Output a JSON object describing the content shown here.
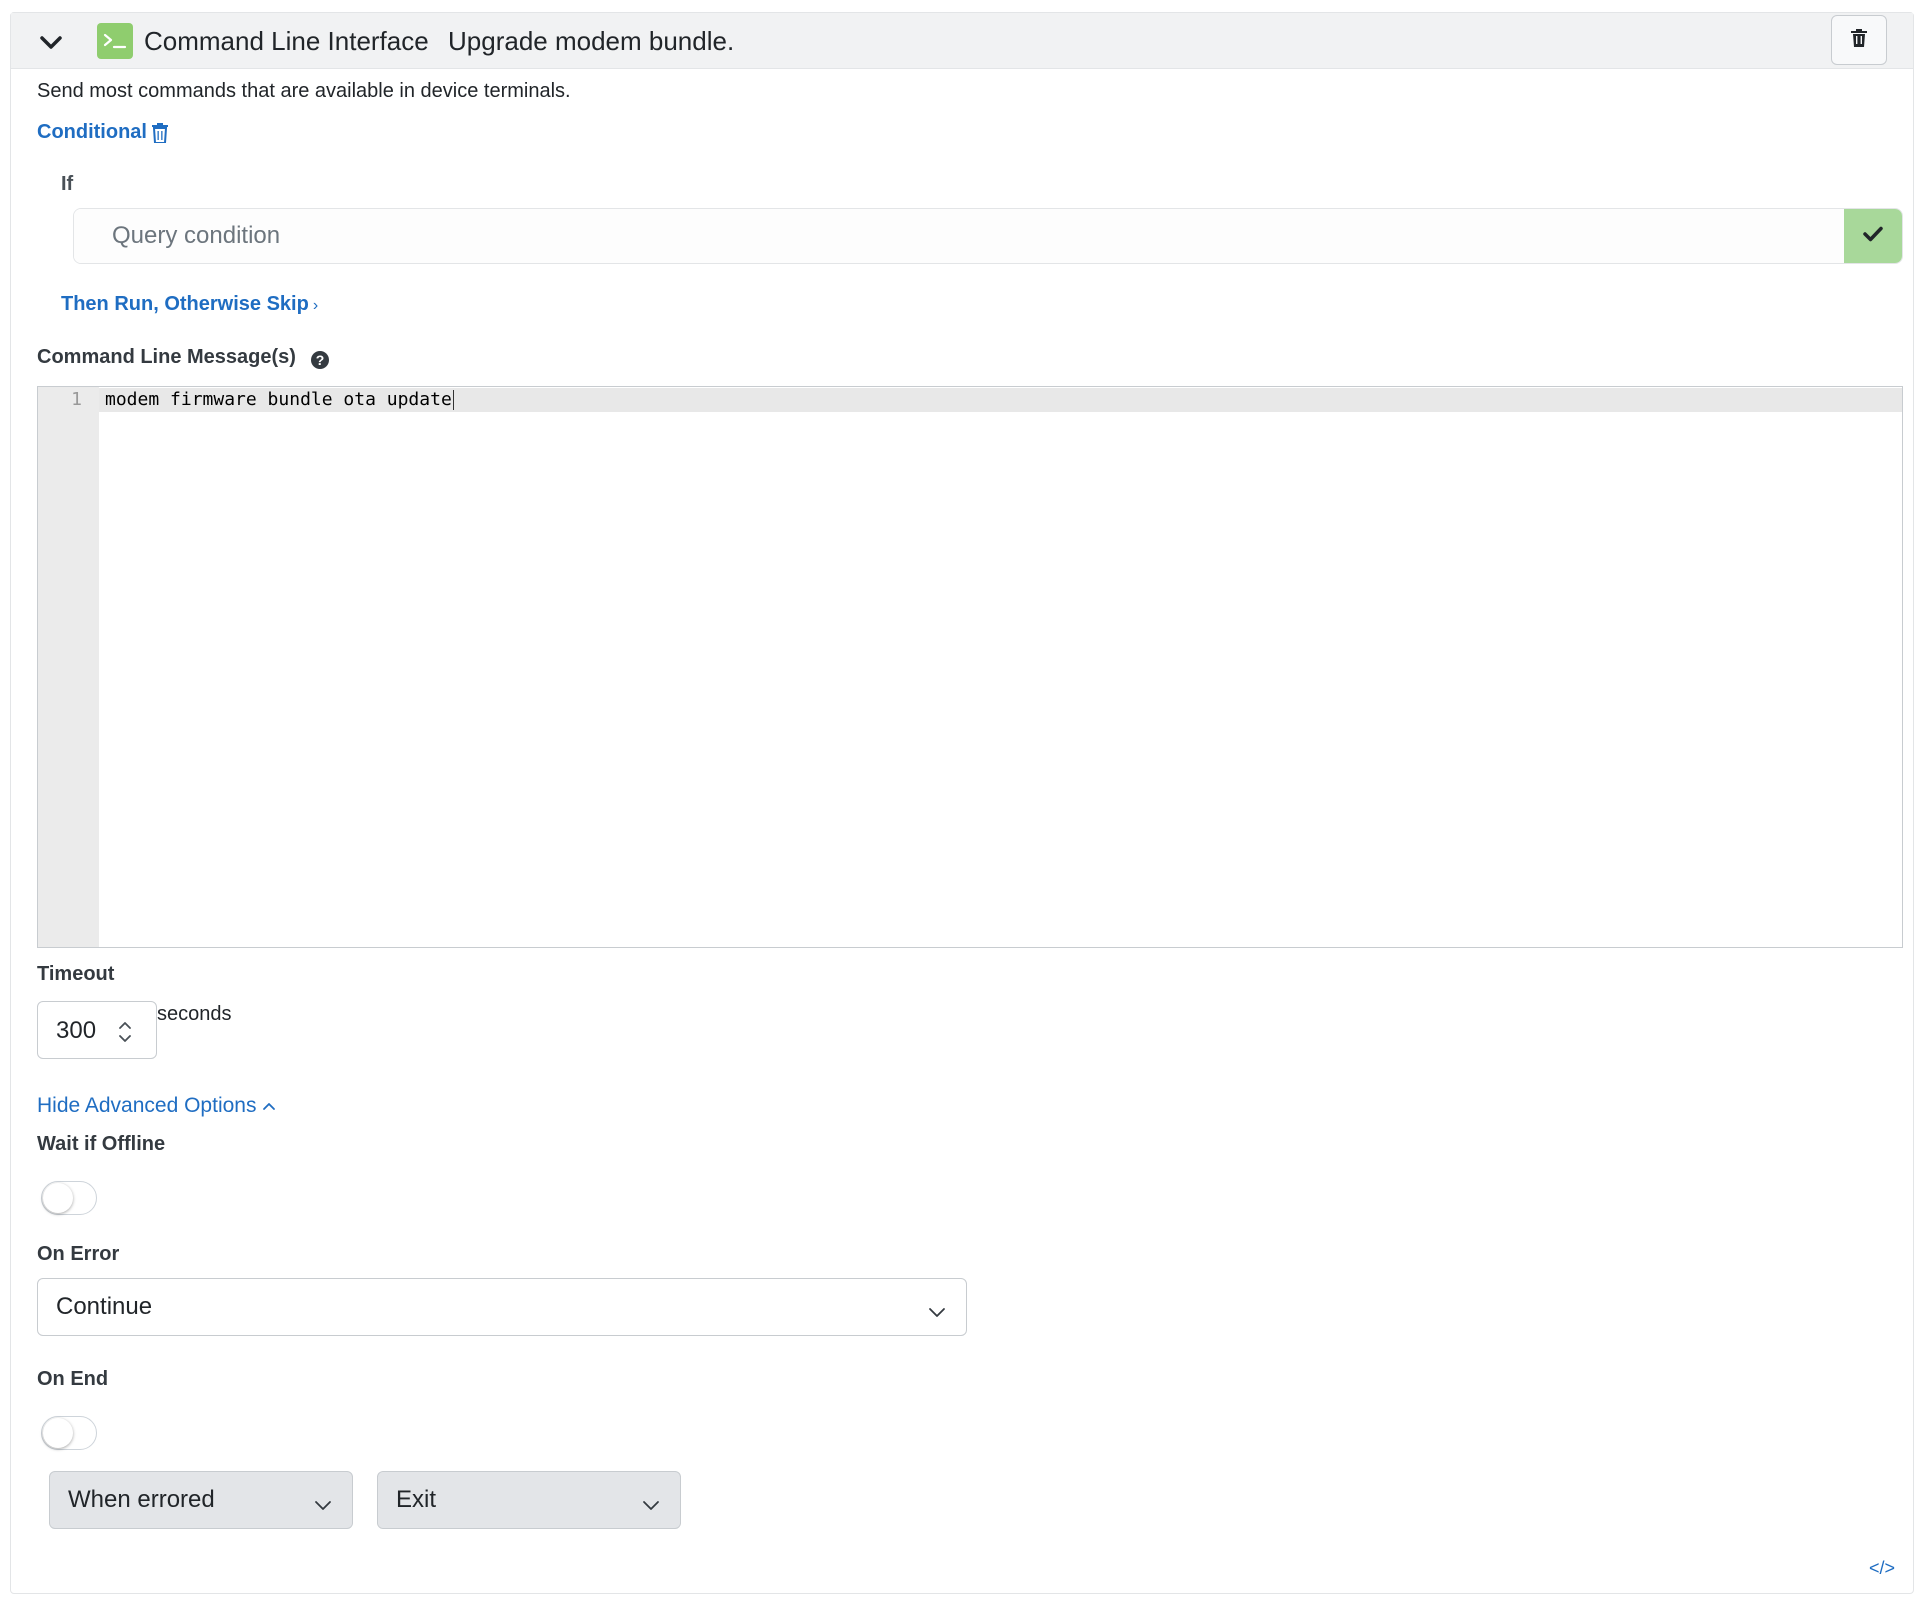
{
  "header": {
    "step_type": "Command Line Interface",
    "step_title": "Upgrade modem bundle."
  },
  "description": "Send most commands that are available in device terminals.",
  "conditional": {
    "label": "Conditional",
    "if_label": "If",
    "query_placeholder": "Query condition",
    "then_run_label": "Then Run, Otherwise Skip",
    "then_run_chevron": "›"
  },
  "command": {
    "label": "Command Line Message(s)",
    "help_glyph": "?",
    "lines": [
      {
        "number": "1",
        "text": "modem firmware bundle ota update"
      }
    ]
  },
  "timeout": {
    "label": "Timeout",
    "value": "300",
    "unit": "seconds"
  },
  "advanced": {
    "toggle_label": "Hide Advanced Options",
    "toggle_chevron": "^"
  },
  "wait_if_offline": {
    "label": "Wait if Offline",
    "enabled": false
  },
  "on_error": {
    "label": "On Error",
    "selected": "Continue"
  },
  "on_end": {
    "label": "On End",
    "enabled": false,
    "condition_selected": "When errored",
    "action_selected": "Exit"
  },
  "footer": {
    "embed_glyph": "</>"
  },
  "colors": {
    "accent_blue": "#1f6dc2",
    "cli_icon_green": "#8fcd6e",
    "query_submit_green": "#a8d89a",
    "header_bg": "#f1f2f3"
  }
}
